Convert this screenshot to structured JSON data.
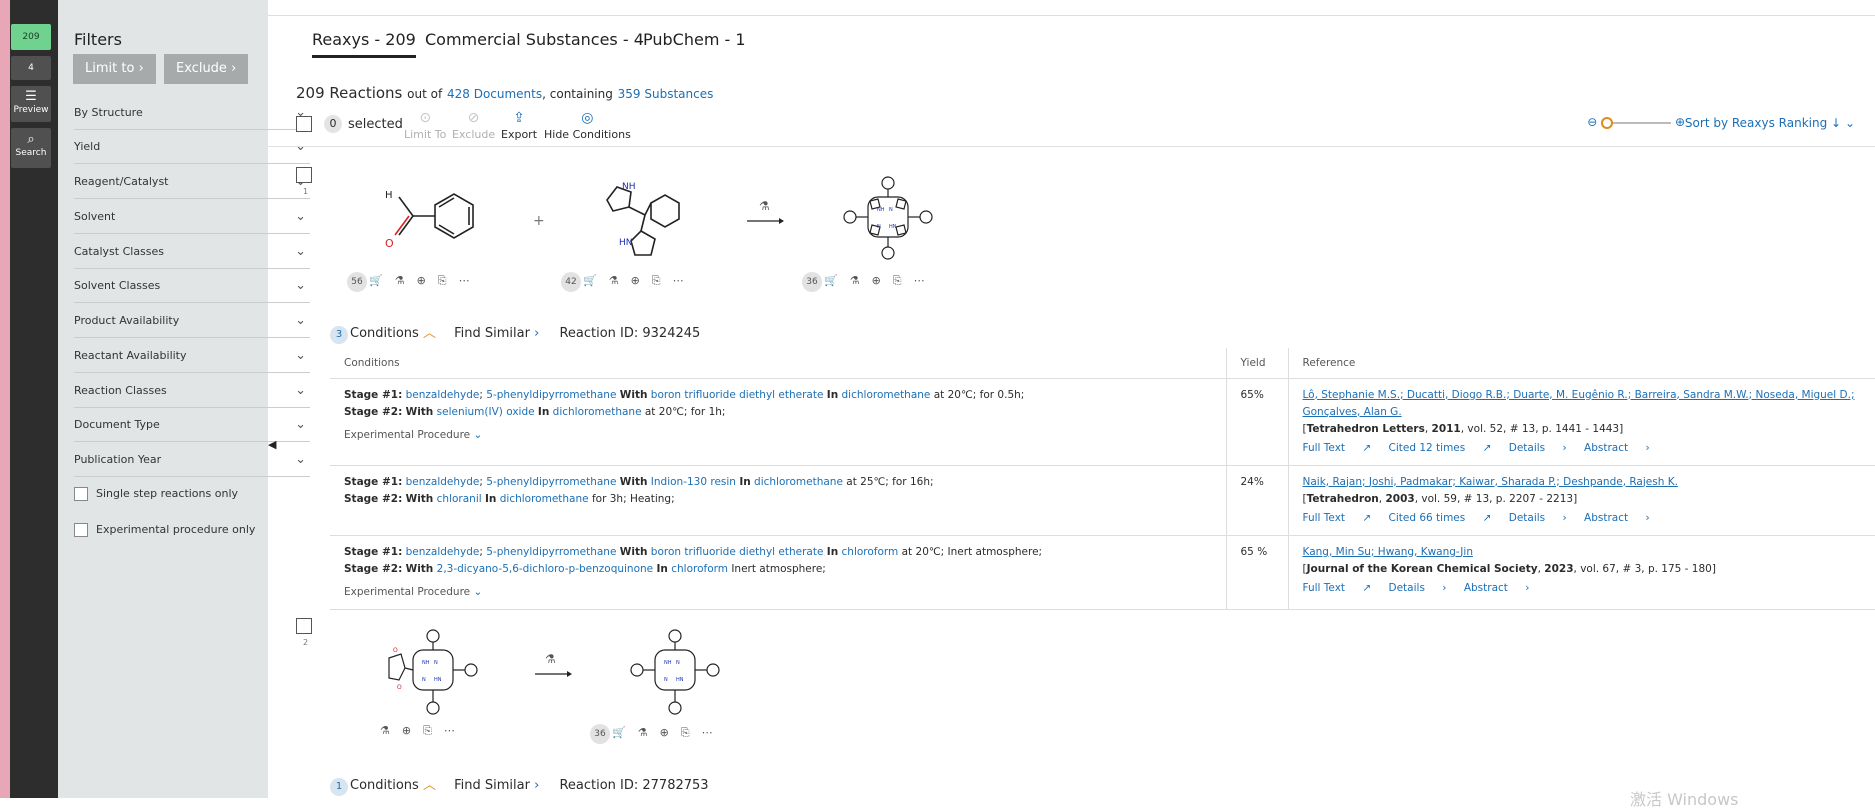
{
  "rail": {
    "top_count": "209",
    "second_count": "4",
    "preview_label": "Preview",
    "search_label": "Search"
  },
  "filters": {
    "title": "Filters",
    "limit_to": "Limit to",
    "exclude": "Exclude",
    "items": [
      "By Structure",
      "Yield",
      "Reagent/Catalyst",
      "Solvent",
      "Catalyst Classes",
      "Solvent Classes",
      "Product Availability",
      "Reactant Availability",
      "Reaction Classes",
      "Document Type",
      "Publication Year"
    ],
    "checkboxes": [
      "Single step reactions only",
      "Experimental procedure only"
    ]
  },
  "tabs": [
    "Reaxys - 209",
    "Commercial Substances - 4",
    "PubChem - 1"
  ],
  "summary": {
    "count": "209 Reactions",
    "out_of": "out of",
    "documents": "428 Documents",
    "containing": ", containing",
    "substances": "359 Substances"
  },
  "toolbar": {
    "selected_count": "0",
    "selected_label": "selected",
    "limit_to": "Limit To",
    "exclude": "Exclude",
    "export": "Export",
    "hide_conditions": "Hide Conditions",
    "sort": "Sort by Reaxys Ranking"
  },
  "reaction1": {
    "number": "1",
    "mol_badges": [
      "56",
      "42",
      "36"
    ],
    "conditions_count": "3",
    "conditions_label": "Conditions",
    "find_similar": "Find Similar",
    "reaction_id": "Reaction ID: 9324245",
    "headers": [
      "Conditions",
      "Yield",
      "Reference"
    ],
    "rows": [
      {
        "stage1_label": "Stage #1:",
        "stage1_a": "benzaldehyde",
        "stage1_b": "5-phenyldipyrromethane",
        "stage1_with_word": "With",
        "stage1_with": "boron trifluoride diethyl etherate",
        "stage1_in_word": "In",
        "stage1_in": "dichloromethane",
        "stage1_rest": "at 20℃; for 0.5h;",
        "stage2_label": "Stage #2:",
        "stage2_with_word": "With",
        "stage2_with": "selenium(IV) oxide",
        "stage2_in_word": "In",
        "stage2_in": "dichloromethane",
        "stage2_rest": "at 20℃; for 1h;",
        "exp": "Experimental Procedure",
        "yield": "65%",
        "authors": "Lô, Stephanie M.S.; Ducatti, Diogo R.B.; Duarte, M. Eugênio R.; Barreira, Sandra M.W.; Noseda, Miguel D.; Gonçalves, Alan G.",
        "journal": "Tetrahedron Letters",
        "year": "2011",
        "citation": ", vol. 52, # 13, p. 1441 - 1443",
        "full_text": "Full Text",
        "cited": "Cited 12 times",
        "details": "Details",
        "abstract": "Abstract"
      },
      {
        "stage1_label": "Stage #1:",
        "stage1_a": "benzaldehyde",
        "stage1_b": "5-phenyldipyrromethane",
        "stage1_with_word": "With",
        "stage1_with": "Indion-130 resin",
        "stage1_in_word": "In",
        "stage1_in": "dichloromethane",
        "stage1_rest": "at 25℃; for 16h;",
        "stage2_label": "Stage #2:",
        "stage2_with_word": "With",
        "stage2_with": "chloranil",
        "stage2_in_word": "In",
        "stage2_in": "dichloromethane",
        "stage2_rest": "for 3h; Heating;",
        "yield": "24%",
        "authors": "Naik, Rajan; Joshi, Padmakar; Kaiwar, Sharada P.; Deshpande, Rajesh K.",
        "journal": "Tetrahedron",
        "year": "2003",
        "citation": ", vol. 59, # 13, p. 2207 - 2213",
        "full_text": "Full Text",
        "cited": "Cited 66 times",
        "details": "Details",
        "abstract": "Abstract"
      },
      {
        "stage1_label": "Stage #1:",
        "stage1_a": "benzaldehyde",
        "stage1_b": "5-phenyldipyrromethane",
        "stage1_with_word": "With",
        "stage1_with": "boron trifluoride diethyl etherate",
        "stage1_in_word": "In",
        "stage1_in": "chloroform",
        "stage1_rest": "at 20℃; Inert atmosphere;",
        "stage2_label": "Stage #2:",
        "stage2_with_word": "With",
        "stage2_with": "2,3-dicyano-5,6-dichloro-p-benzoquinone",
        "stage2_in_word": "In",
        "stage2_in": "chloroform",
        "stage2_rest": "Inert atmosphere;",
        "exp": "Experimental Procedure",
        "yield": "65 %",
        "authors": "Kang, Min Su; Hwang, Kwang-Jin",
        "journal": "Journal of the Korean Chemical Society",
        "year": "2023",
        "citation": ", vol. 67, # 3, p. 175 - 180",
        "full_text": "Full Text",
        "details": "Details",
        "abstract": "Abstract"
      }
    ]
  },
  "reaction2": {
    "number": "2",
    "mol_badges": [
      "36"
    ],
    "conditions_count": "1",
    "conditions_label": "Conditions",
    "find_similar": "Find Similar",
    "reaction_id": "Reaction ID: 27782753"
  },
  "watermark": "激活 Windows"
}
